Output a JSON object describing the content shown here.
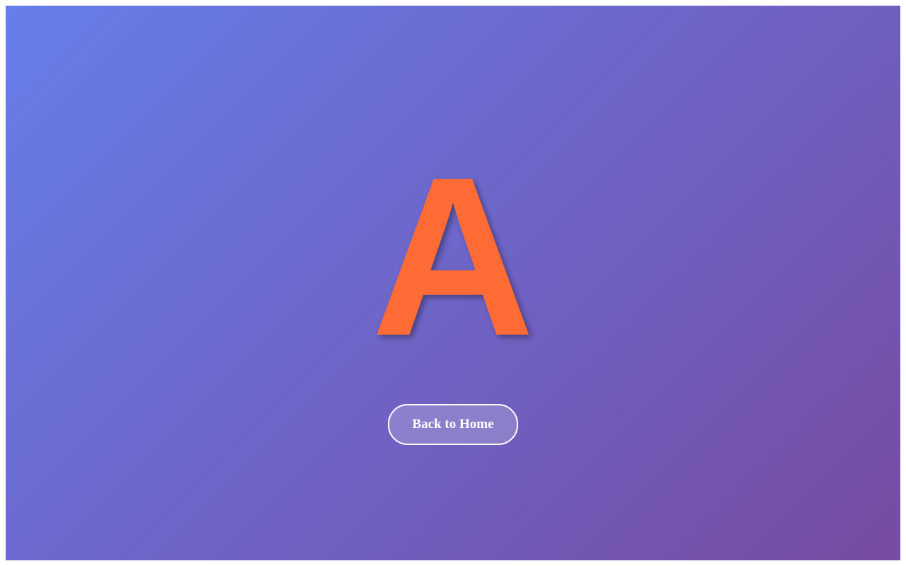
{
  "display": {
    "letter": "A",
    "letter_color": "#ff6b35"
  },
  "background": {
    "gradient_start": "#667eea",
    "gradient_end": "#764ba2"
  },
  "actions": {
    "back_to_home_label": "Back to Home"
  }
}
